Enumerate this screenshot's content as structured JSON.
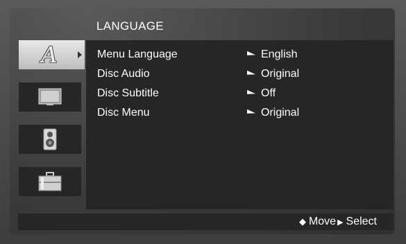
{
  "menu": {
    "title": "LANGUAGE",
    "tabs": [
      {
        "name": "language",
        "icon": "language-a-icon",
        "active": true
      },
      {
        "name": "display",
        "icon": "tv-icon",
        "active": false
      },
      {
        "name": "audio",
        "icon": "speaker-icon",
        "active": false
      },
      {
        "name": "others",
        "icon": "toolbox-icon",
        "active": false
      }
    ],
    "tab_glyph": "A",
    "items": [
      {
        "label": "Menu Language",
        "value": "English"
      },
      {
        "label": "Disc Audio",
        "value": "Original"
      },
      {
        "label": "Disc Subtitle",
        "value": "Off"
      },
      {
        "label": "Disc Menu",
        "value": "Original"
      }
    ]
  },
  "status": {
    "move_label": "Move",
    "select_label": "Select"
  }
}
